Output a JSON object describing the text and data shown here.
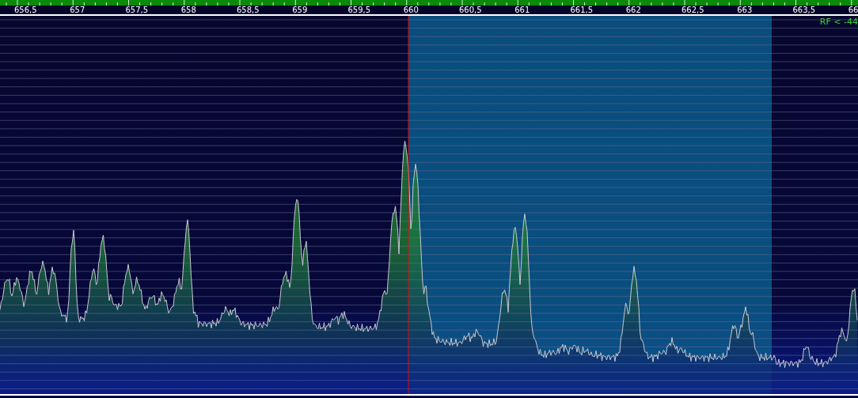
{
  "frequency_axis": {
    "labels": [
      "656,5",
      "657",
      "657,5",
      "658",
      "658,5",
      "659",
      "659,5",
      "660",
      "660,5",
      "661",
      "661,5",
      "662",
      "662,5",
      "663",
      "663,5",
      "66"
    ]
  },
  "rf_threshold": "RF < -44"
}
